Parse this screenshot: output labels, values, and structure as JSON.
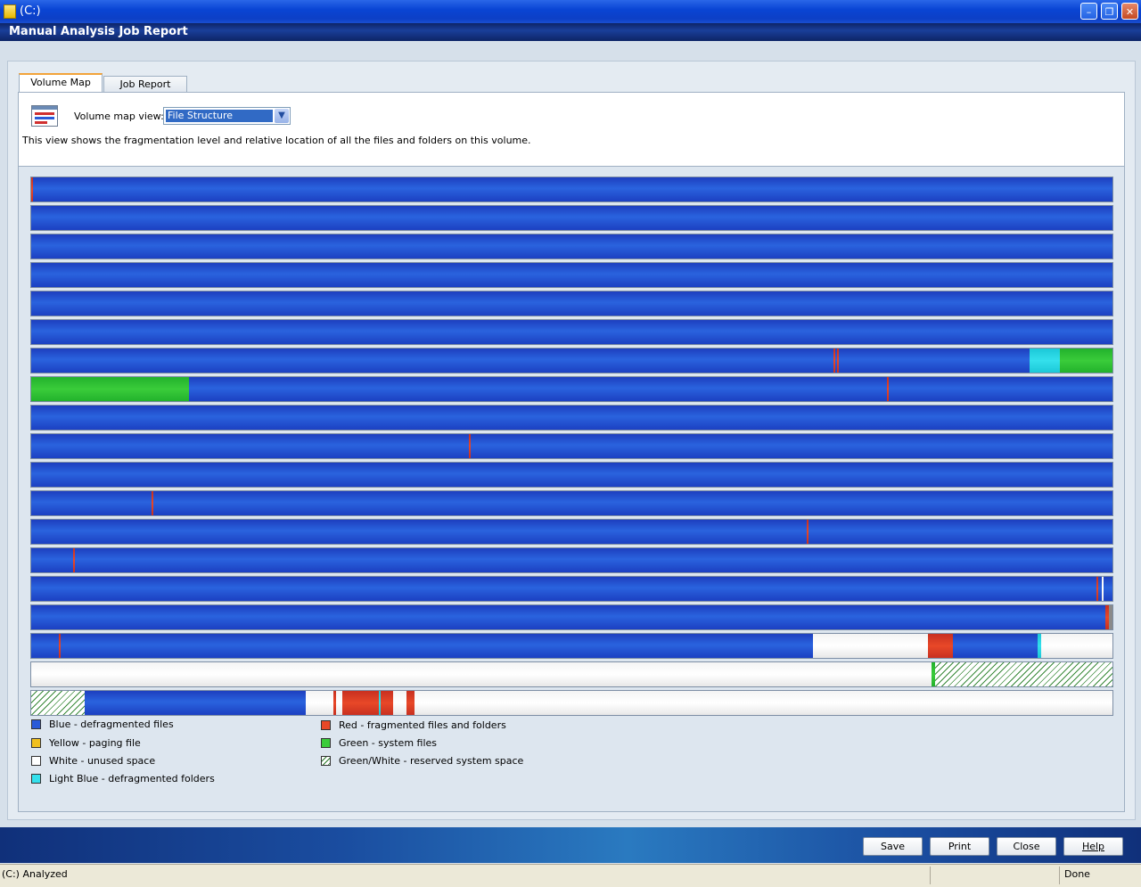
{
  "window": {
    "title": "(C:)"
  },
  "header": {
    "title": "Manual Analysis Job Report"
  },
  "tabs": [
    {
      "label": "Volume Map"
    },
    {
      "label": "Job Report"
    }
  ],
  "view": {
    "label": "Volume map view:",
    "selected": "File Structure",
    "description": "This view shows the fragmentation level and relative location of all the files and folders on this volume."
  },
  "colors": {
    "blue": "#2a63de",
    "red": "#e84828",
    "green": "#3acc3a",
    "cyan": "#34e0ec",
    "yellow": "#f0c020",
    "white": "#ffffff"
  },
  "legend": [
    {
      "color": "blue",
      "label": "Blue - defragmented files"
    },
    {
      "color": "yellow",
      "label": "Yellow - paging file"
    },
    {
      "color": "white",
      "label": "White - unused space"
    },
    {
      "color": "cyan",
      "label": "Light Blue - defragmented folders"
    },
    {
      "color": "red",
      "label": "Red - fragmented files and folders"
    },
    {
      "color": "green",
      "label": "Green - system files"
    },
    {
      "color": "hatch",
      "label": "Green/White - reserved system space"
    }
  ],
  "buttons": {
    "save": "Save",
    "print": "Print",
    "close": "Close",
    "help": "Help"
  },
  "status": {
    "left": "(C:) Analyzed",
    "right": "Done"
  }
}
